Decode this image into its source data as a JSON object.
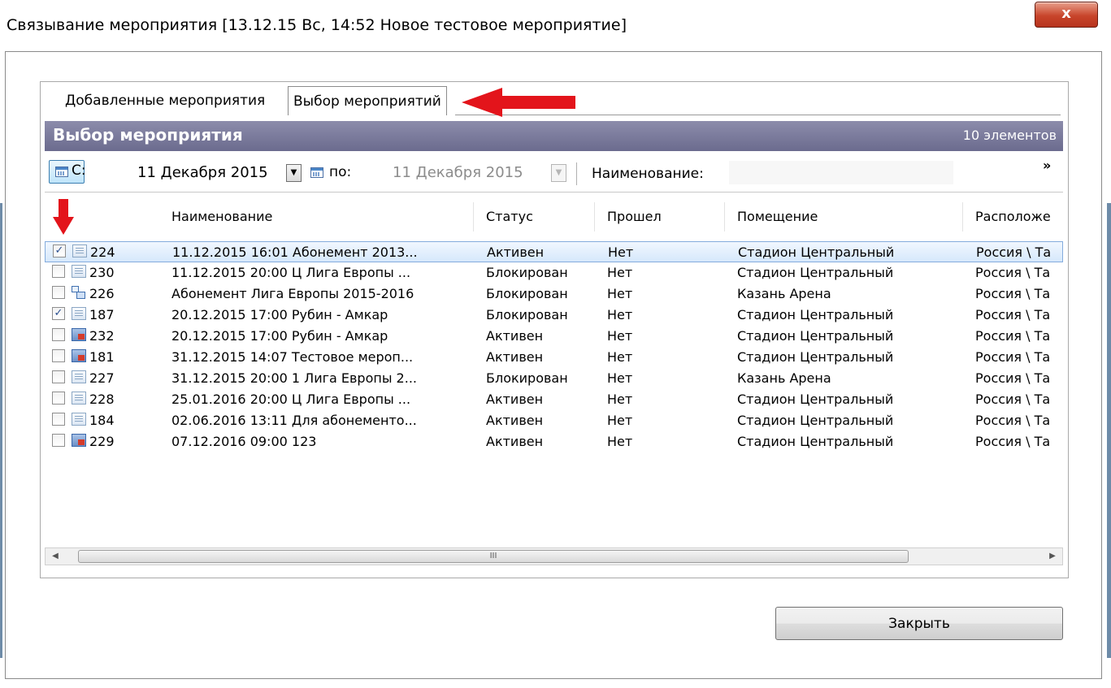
{
  "window": {
    "title": "Связывание мероприятия [13.12.15 Вс, 14:52 Новое тестовое мероприятие]",
    "close_glyph": "x"
  },
  "tabs": [
    {
      "label": "Добавленные мероприятия",
      "active": false
    },
    {
      "label": "Выбор мероприятий",
      "active": true
    }
  ],
  "group": {
    "title": "Выбор мероприятия",
    "count": "10 элементов"
  },
  "filter": {
    "from_label": "С:",
    "from_date": "11 Декабря 2015",
    "to_label": "по:",
    "to_date": "11 Декабря 2015",
    "name_label": "Наименование:",
    "name_value": "",
    "more_glyph": "»"
  },
  "grid": {
    "columns": [
      "Наименование",
      "Статус",
      "Прошел",
      "Помещение",
      "Расположе"
    ],
    "rows": [
      {
        "checked": true,
        "icon": "list-icon",
        "id": "224",
        "name": "11.12.2015 16:01 Абонемент 2013...",
        "status": "Активен",
        "passed": "Нет",
        "room": "Стадион Центральный",
        "location": "Россия \\ Та"
      },
      {
        "checked": false,
        "icon": "list-icon",
        "id": "230",
        "name": "11.12.2015 20:00 Ц Лига Европы ...",
        "status": "Блокирован",
        "passed": "Нет",
        "room": "Стадион Центральный",
        "location": "Россия \\ Та"
      },
      {
        "checked": false,
        "icon": "tree-icon",
        "id": "226",
        "name": "Абонемент Лига Европы 2015-2016",
        "status": "Блокирован",
        "passed": "Нет",
        "room": "Казань Арена",
        "location": "Россия \\ Та"
      },
      {
        "checked": true,
        "icon": "list-icon",
        "id": "187",
        "name": "20.12.2015 17:00 Рубин - Амкар",
        "status": "Блокирован",
        "passed": "Нет",
        "room": "Стадион Центральный",
        "location": "Россия \\ Та"
      },
      {
        "checked": false,
        "icon": "schedule-icon",
        "id": "232",
        "name": "20.12.2015 17:00 Рубин - Амкар",
        "status": "Активен",
        "passed": "Нет",
        "room": "Стадион Центральный",
        "location": "Россия \\ Та"
      },
      {
        "checked": false,
        "icon": "schedule-icon",
        "id": "181",
        "name": "31.12.2015 14:07 Тестовое мероп...",
        "status": "Активен",
        "passed": "Нет",
        "room": "Стадион Центральный",
        "location": "Россия \\ Та"
      },
      {
        "checked": false,
        "icon": "list-icon",
        "id": "227",
        "name": "31.12.2015 20:00 1 Лига Европы 2...",
        "status": "Блокирован",
        "passed": "Нет",
        "room": "Казань Арена",
        "location": "Россия \\ Та"
      },
      {
        "checked": false,
        "icon": "list-icon",
        "id": "228",
        "name": "25.01.2016 20:00 Ц Лига Европы ...",
        "status": "Активен",
        "passed": "Нет",
        "room": "Стадион Центральный",
        "location": "Россия \\ Та"
      },
      {
        "checked": false,
        "icon": "list-icon",
        "id": "184",
        "name": "02.06.2016 13:11 Для абонементо...",
        "status": "Активен",
        "passed": "Нет",
        "room": "Стадион Центральный",
        "location": "Россия \\ Та"
      },
      {
        "checked": false,
        "icon": "schedule-icon",
        "id": "229",
        "name": "07.12.2016 09:00 123",
        "status": "Активен",
        "passed": "Нет",
        "room": "Стадион Центральный",
        "location": "Россия \\ Та"
      }
    ],
    "scroll_grip": "III"
  },
  "footer": {
    "close_label": "Закрыть"
  },
  "colors": {
    "annotation_arrow": "#e3141b",
    "group_header": "#7a7a9c",
    "selected_row": "#d6e8fc"
  }
}
